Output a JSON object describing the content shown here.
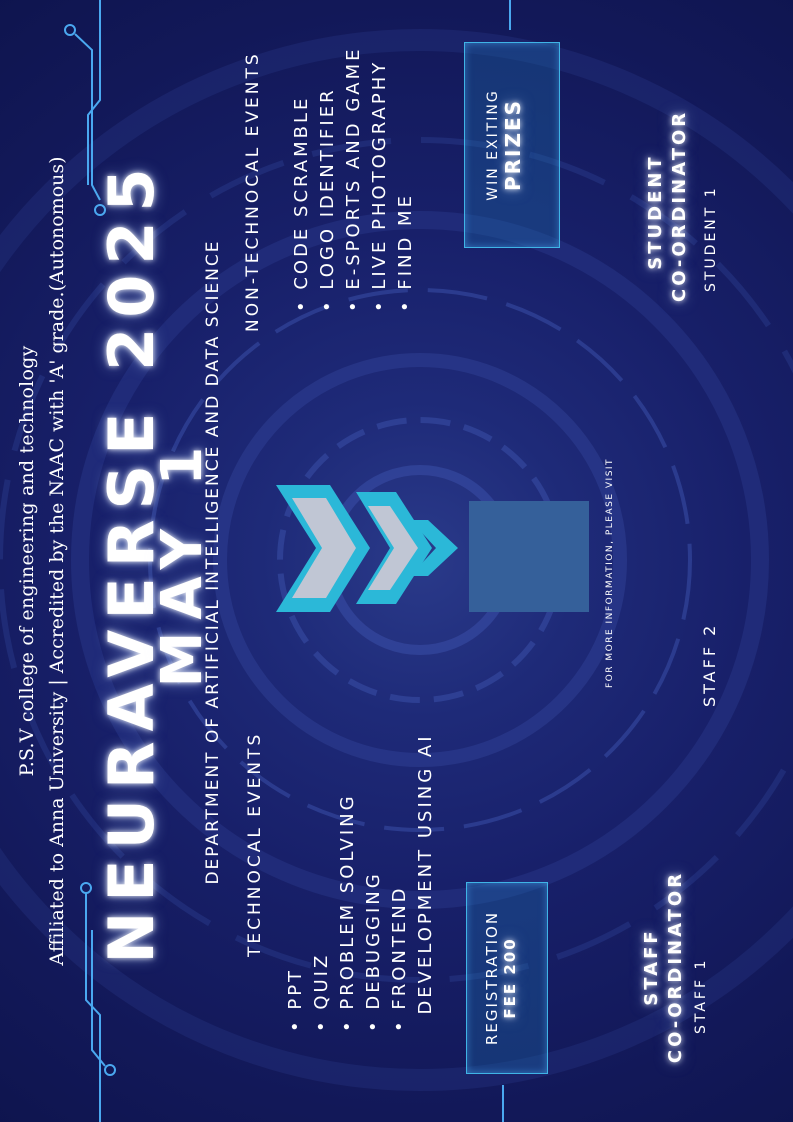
{
  "college": {
    "line1": "P.S.V college of engineering and technology",
    "line2": "Affiliated to Anna University | Accredited by the  NAAC with 'A' grade.(Autonomous)"
  },
  "event": {
    "title": "NEURAVERSE 2025",
    "date": "MAY 1",
    "department": "DEPARTMENT OF ARTIFICIAL INTELLIGENCE AND DATA SCIENCE"
  },
  "technical": {
    "heading": "TECHNOCAL  EVENTS",
    "items": [
      "• PPT",
      "• QUIZ",
      "• PROBLEM SOLVING",
      "• DEBUGGING",
      "• FRONTEND",
      "  DEVELOPMENT USING AI"
    ]
  },
  "non_technical": {
    "heading": "NON-TECHNOCAL EVENTS",
    "items": [
      "• CODE SCRAMBLE",
      "• LOGO IDENTIFIER",
      "• E-SPORTS AND GAME",
      "• LIVE PHOTOGRAPHY",
      "• FIND ME"
    ]
  },
  "registration": {
    "line1": "REGISTRATION",
    "line2": "FEE 200"
  },
  "prizes": {
    "line1": "WIN EXITING",
    "line2": "PRIZES"
  },
  "more_info": "FOR MORE INFORMATION, PLEASE VISIT",
  "staff": {
    "heading1": "STAFF",
    "heading2": "CO-ORDINATOR",
    "staff1": "STAFF 1",
    "staff2": "STAFF 2"
  },
  "student": {
    "heading1": "STUDENT",
    "heading2": "CO-ORDINATOR",
    "student1": "STUDENT 1"
  },
  "colors": {
    "background": "#141a58",
    "accent": "#3fb4e6",
    "logo_cyan": "#2bb8d8",
    "logo_silver": "#c0c6d4"
  },
  "icons": [
    "circuit-lines",
    "ai-chevron-logo",
    "qr-code-placeholder"
  ]
}
